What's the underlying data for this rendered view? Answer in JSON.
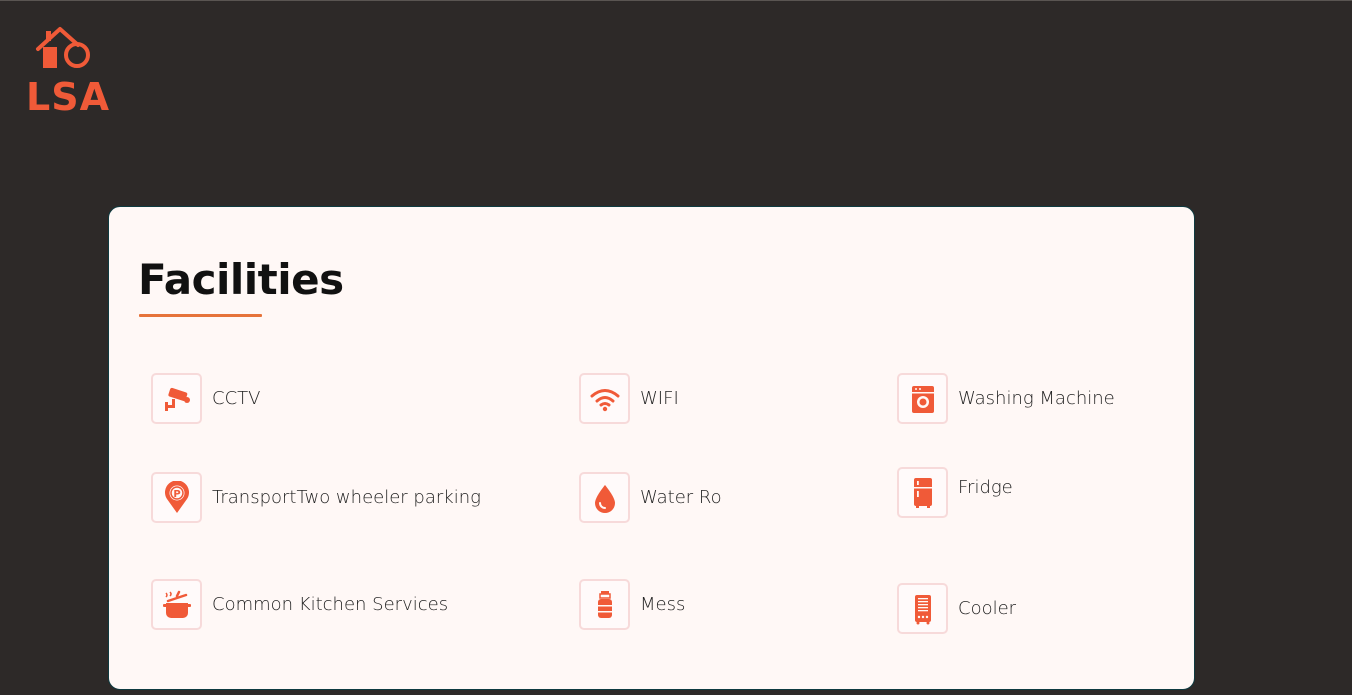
{
  "brand": {
    "logo_text": "LSA",
    "accent": "#f05a38"
  },
  "section": {
    "title": "Facilities"
  },
  "facilities": [
    {
      "label": "CCTV",
      "icon": "cctv-camera-icon"
    },
    {
      "label": "WIFI",
      "icon": "wifi-icon"
    },
    {
      "label": "Washing Machine",
      "icon": "washing-machine-icon"
    },
    {
      "label": "TransportTwo wheeler parking",
      "icon": "parking-pin-icon"
    },
    {
      "label": "Water Ro",
      "icon": "water-drop-icon"
    },
    {
      "label": "Fridge",
      "icon": "fridge-icon"
    },
    {
      "label": "Common Kitchen Services",
      "icon": "cooking-pot-icon"
    },
    {
      "label": "Mess",
      "icon": "gas-cylinder-icon"
    },
    {
      "label": "Cooler",
      "icon": "air-cooler-icon"
    }
  ]
}
